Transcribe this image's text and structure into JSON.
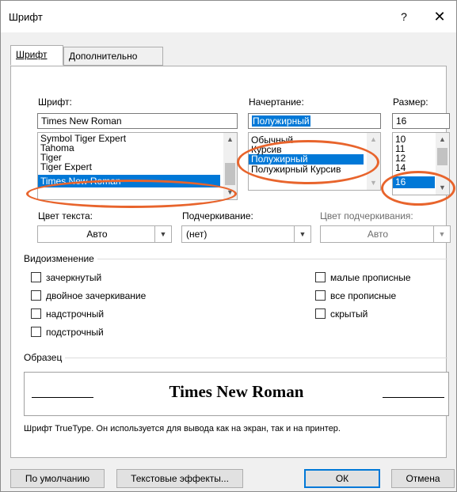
{
  "dialog": {
    "title": "Шрифт",
    "help": "?",
    "close": "✕"
  },
  "tabs": [
    {
      "label": "Шрифт"
    },
    {
      "label": "Дополнительно"
    }
  ],
  "font": {
    "label": "Шрифт:",
    "value": "Times New Roman",
    "items": [
      "Symbol Tiger Expert",
      "Tahoma",
      "Tiger",
      "Tiger Expert",
      "Times New Roman"
    ],
    "selected": "Times New Roman"
  },
  "style": {
    "label": "Начертание:",
    "value": "Полужирный",
    "items": [
      "Обычный",
      "Курсив",
      "Полужирный",
      "Полужирный Курсив"
    ],
    "selected": "Полужирный"
  },
  "size": {
    "label": "Размер:",
    "value": "16",
    "items": [
      "10",
      "11",
      "12",
      "14",
      "16"
    ],
    "selected": "16"
  },
  "font_color": {
    "label": "Цвет текста:",
    "value": "Авто"
  },
  "underline": {
    "label": "Подчеркивание:",
    "value": "(нет)"
  },
  "underline_color": {
    "label": "Цвет подчеркивания:",
    "value": "Авто"
  },
  "effects": {
    "title": "Видоизменение",
    "left": [
      "зачеркнутый",
      "двойное зачеркивание",
      "надстрочный",
      "подстрочный"
    ],
    "right": [
      "малые прописные",
      "все прописные",
      "скрытый"
    ]
  },
  "preview": {
    "title": "Образец",
    "text": "Times New Roman",
    "description": "Шрифт TrueType. Он используется для вывода как на экран, так и на принтер."
  },
  "buttons": {
    "default": "По умолчанию",
    "text_effects": "Текстовые эффекты...",
    "ok": "ОК",
    "cancel": "Отмена"
  },
  "colors": {
    "selection": "#0078d7",
    "annotation": "#e8642c"
  },
  "icons": {
    "scroll_up": "chevron-up-icon",
    "scroll_down": "chevron-down-icon",
    "dropdown": "chevron-down-icon",
    "close": "close-icon",
    "help": "help-icon"
  }
}
